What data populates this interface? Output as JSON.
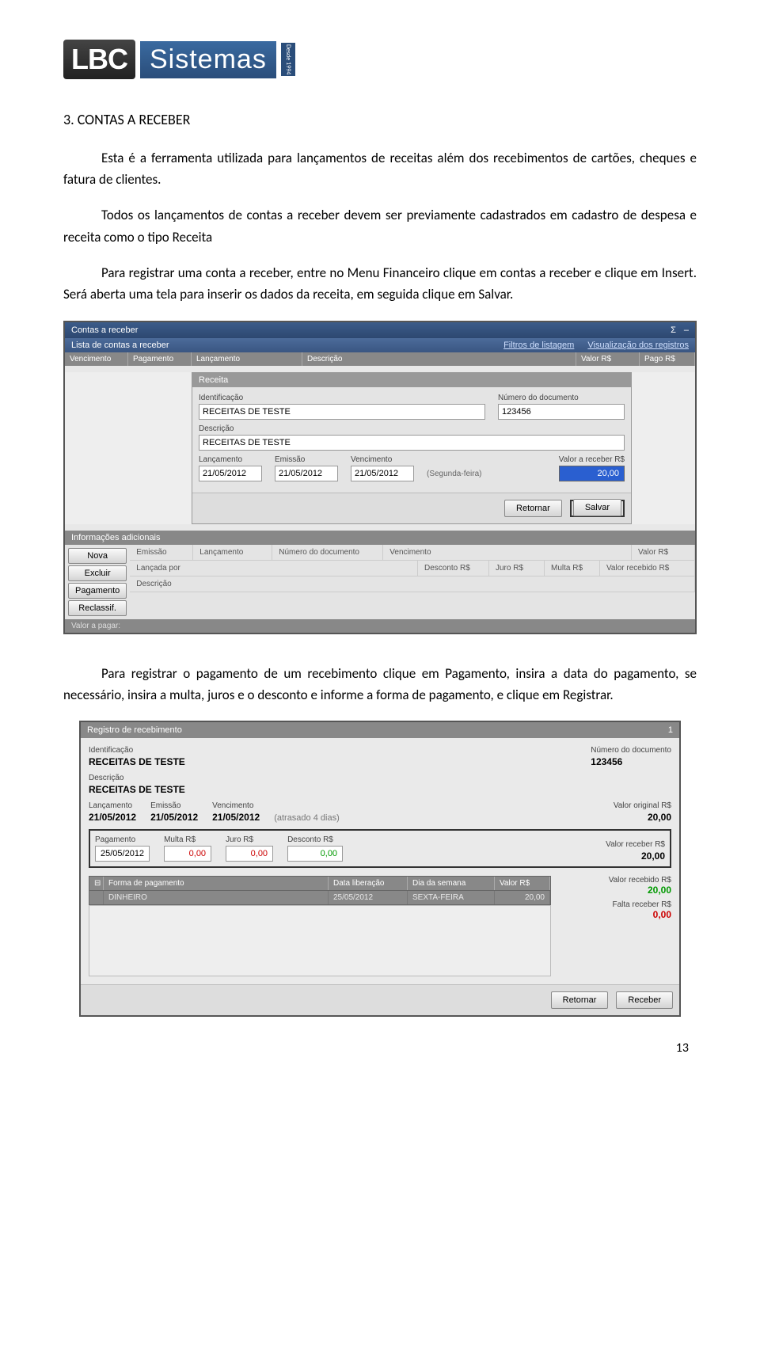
{
  "logo": {
    "part1": "LBC",
    "part2": "Sistemas",
    "badge": "Desde 1994"
  },
  "section_title": "3. CONTAS A RECEBER",
  "para1": "Esta é a ferramenta utilizada para lançamentos de receitas além dos recebimentos de cartões, cheques e fatura de clientes.",
  "para2": "Todos os lançamentos de contas a receber devem ser previamente cadastrados em cadastro de despesa e receita como o tipo Receita",
  "para3": "Para registrar uma conta a receber, entre no Menu Financeiro clique em contas a receber e clique em Insert. Será aberta uma tela para inserir os dados da receita, em seguida clique em Salvar.",
  "para4": "Para registrar o pagamento de um recebimento clique em Pagamento, insira a data do pagamento, se necessário, insira a multa, juros e o desconto e informe a forma de pagamento, e clique em Registrar.",
  "page_num": "13",
  "ss1": {
    "title": "Contas a receber",
    "sigma": "Σ",
    "subhead": "Lista de contas a receber",
    "link1": "Filtros de listagem",
    "link2": "Visualização dos registros",
    "cols": {
      "venc": "Vencimento",
      "pag": "Pagamento",
      "lanc": "Lançamento",
      "desc": "Descrição",
      "valor": "Valor R$",
      "pago": "Pago R$"
    },
    "dialog": {
      "title": "Receita",
      "ident_lbl": "Identificação",
      "ident_val": "RECEITAS DE TESTE",
      "num_lbl": "Número do documento",
      "num_val": "123456",
      "desc_lbl": "Descrição",
      "desc_val": "RECEITAS DE TESTE",
      "lanc_lbl": "Lançamento",
      "lanc_val": "21/05/2012",
      "emi_lbl": "Emissão",
      "emi_val": "21/05/2012",
      "venc_lbl": "Vencimento",
      "venc_val": "21/05/2012",
      "weekday": "(Segunda-feira)",
      "valrec_lbl": "Valor a receber R$",
      "valrec_val": "20,00",
      "btn_ret": "Retornar",
      "btn_sal": "Salvar"
    },
    "info_title": "Informações adicionais",
    "sidebtns": {
      "nova": "Nova",
      "excluir": "Excluir",
      "pag": "Pagamento",
      "recl": "Reclassif."
    },
    "lowercols": {
      "emi": "Emissão",
      "lanc": "Lançamento",
      "num": "Número do documento",
      "venc": "Vencimento",
      "valor": "Valor R$",
      "lancpor": "Lançada por",
      "desconto": "Desconto R$",
      "juro": "Juro R$",
      "multa": "Multa R$",
      "valrec": "Valor recebido R$",
      "desc": "Descrição"
    },
    "foot": "Valor a pagar:"
  },
  "ss2": {
    "title": "Registro de recebimento",
    "titlenum": "1",
    "ident_lbl": "Identificação",
    "ident_val": "RECEITAS DE TESTE",
    "num_lbl": "Número do documento",
    "num_val": "123456",
    "desc_lbl": "Descrição",
    "desc_val": "RECEITAS DE TESTE",
    "lanc_lbl": "Lançamento",
    "lanc_val": "21/05/2012",
    "emi_lbl": "Emissão",
    "emi_val": "21/05/2012",
    "venc_lbl": "Vencimento",
    "venc_val": "21/05/2012",
    "late": "(atrasado 4 dias)",
    "valorig_lbl": "Valor original R$",
    "valorig_val": "20,00",
    "pag_lbl": "Pagamento",
    "pag_val": "25/05/2012",
    "multa_lbl": "Multa R$",
    "multa_val": "0,00",
    "juro_lbl": "Juro R$",
    "juro_val": "0,00",
    "desconto_lbl": "Desconto R$",
    "desconto_val": "0,00",
    "valrec_lbl": "Valor receber R$",
    "valrec_val": "20,00",
    "table": {
      "h_forma": "Forma de pagamento",
      "h_data": "Data liberação",
      "h_dia": "Dia da semana",
      "h_valor": "Valor R$",
      "r_forma": "DINHEIRO",
      "r_data": "25/05/2012",
      "r_dia": "SEXTA-FEIRA",
      "r_valor": "20,00",
      "icon": "⊟"
    },
    "side": {
      "valrecd_lbl": "Valor recebido R$",
      "valrecd_val": "20,00",
      "falta_lbl": "Falta receber R$",
      "falta_val": "0,00"
    },
    "btn_ret": "Retornar",
    "btn_rec": "Receber"
  }
}
